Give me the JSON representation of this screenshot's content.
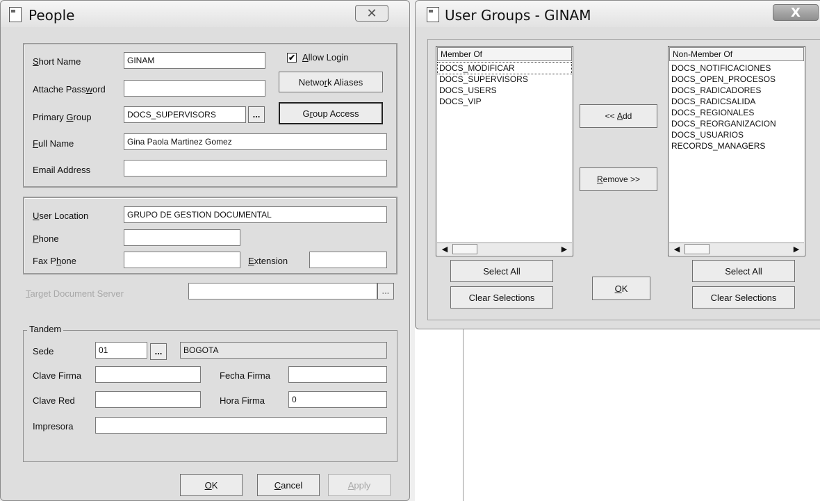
{
  "people_window": {
    "title": "People",
    "close_glyph": "✕",
    "short_name": {
      "label": "Short Name",
      "value": "GINAM"
    },
    "allow_login": {
      "label": "Allow Login",
      "checked": "✔"
    },
    "attache_password": {
      "label": "Attache Password",
      "value": ""
    },
    "network_aliases_label": "Network Aliases",
    "primary_group": {
      "label": "Primary Group",
      "value": "DOCS_SUPERVISORS"
    },
    "group_access_label": "Group Access",
    "full_name": {
      "label": "Full Name",
      "value": "Gina Paola Martinez Gomez"
    },
    "email_address": {
      "label": "Email Address",
      "value": ""
    },
    "user_location": {
      "label": "User Location",
      "value": "GRUPO DE GESTION DOCUMENTAL"
    },
    "phone": {
      "label": "Phone",
      "value": ""
    },
    "fax_phone": {
      "label": "Fax Phone",
      "value": ""
    },
    "extension": {
      "label": "Extension",
      "value": ""
    },
    "target_document_server": {
      "label": "Target Document Server",
      "value": ""
    },
    "tandem": {
      "legend": "Tandem",
      "sede": {
        "label": "Sede",
        "code": "01",
        "name": "BOGOTA"
      },
      "clave_firma": {
        "label": "Clave Firma",
        "value": ""
      },
      "fecha_firma": {
        "label": "Fecha Firma",
        "value": ""
      },
      "clave_red": {
        "label": "Clave Red",
        "value": ""
      },
      "hora_firma": {
        "label": "Hora Firma",
        "value": "0"
      },
      "impresora": {
        "label": "Impresora",
        "value": ""
      }
    },
    "ok_label": "OK",
    "cancel_label": "Cancel",
    "apply_label": "Apply",
    "ellipsis": "..."
  },
  "user_groups_window": {
    "title": "User Groups - GINAM",
    "close_glyph": "X",
    "member_of": {
      "header": "Member Of",
      "items": [
        "DOCS_MODIFICAR",
        "DOCS_SUPERVISORS",
        "DOCS_USERS",
        "DOCS_VIP"
      ]
    },
    "non_member_of": {
      "header": "Non-Member Of",
      "items": [
        "DOCS_NOTIFICACIONES",
        "DOCS_OPEN_PROCESOS",
        "DOCS_RADICADORES",
        "DOCS_RADICSALIDA",
        "DOCS_REGIONALES",
        "DOCS_REORGANIZACION",
        "DOCS_USUARIOS",
        "RECORDS_MANAGERS"
      ]
    },
    "add_label": "<< Add",
    "remove_label": "Remove >>",
    "select_all_label": "Select All",
    "clear_selections_label": "Clear Selections",
    "ok_label": "OK",
    "scroll_left": "◀",
    "scroll_right": "▶"
  }
}
